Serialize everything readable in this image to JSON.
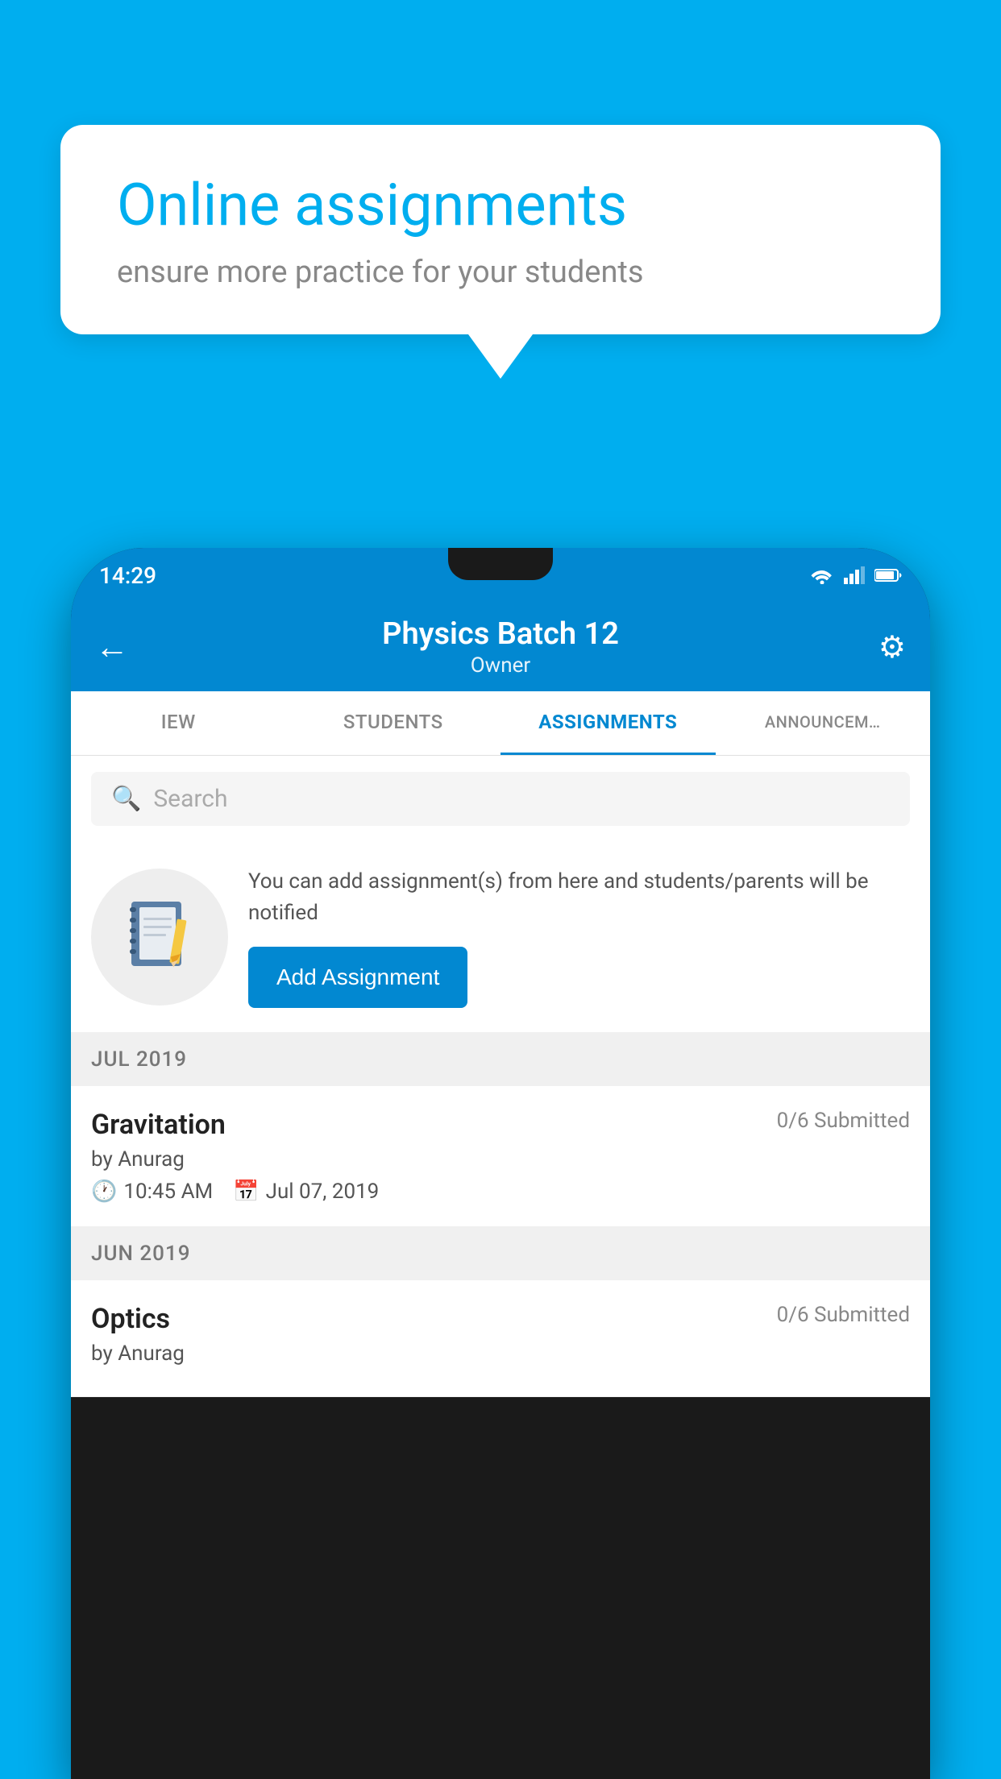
{
  "background": {
    "color": "#00AEEF"
  },
  "speech_bubble": {
    "title": "Online assignments",
    "subtitle": "ensure more practice for your students"
  },
  "status_bar": {
    "time": "14:29",
    "icons": [
      "wifi",
      "signal",
      "battery"
    ]
  },
  "app_bar": {
    "title": "Physics Batch 12",
    "subtitle": "Owner",
    "back_icon": "←",
    "settings_icon": "⚙"
  },
  "tabs": [
    {
      "label": "IEW",
      "active": false
    },
    {
      "label": "STUDENTS",
      "active": false
    },
    {
      "label": "ASSIGNMENTS",
      "active": true
    },
    {
      "label": "ANNOUNCEM…",
      "active": false
    }
  ],
  "search": {
    "placeholder": "Search"
  },
  "info_card": {
    "text": "You can add assignment(s) from here and students/parents will be notified",
    "button_label": "Add Assignment"
  },
  "sections": [
    {
      "month": "JUL 2019",
      "assignments": [
        {
          "name": "Gravitation",
          "submitted": "0/6 Submitted",
          "by": "by Anurag",
          "time": "10:45 AM",
          "date": "Jul 07, 2019"
        }
      ]
    },
    {
      "month": "JUN 2019",
      "assignments": [
        {
          "name": "Optics",
          "submitted": "0/6 Submitted",
          "by": "by Anurag",
          "time": "",
          "date": ""
        }
      ]
    }
  ]
}
